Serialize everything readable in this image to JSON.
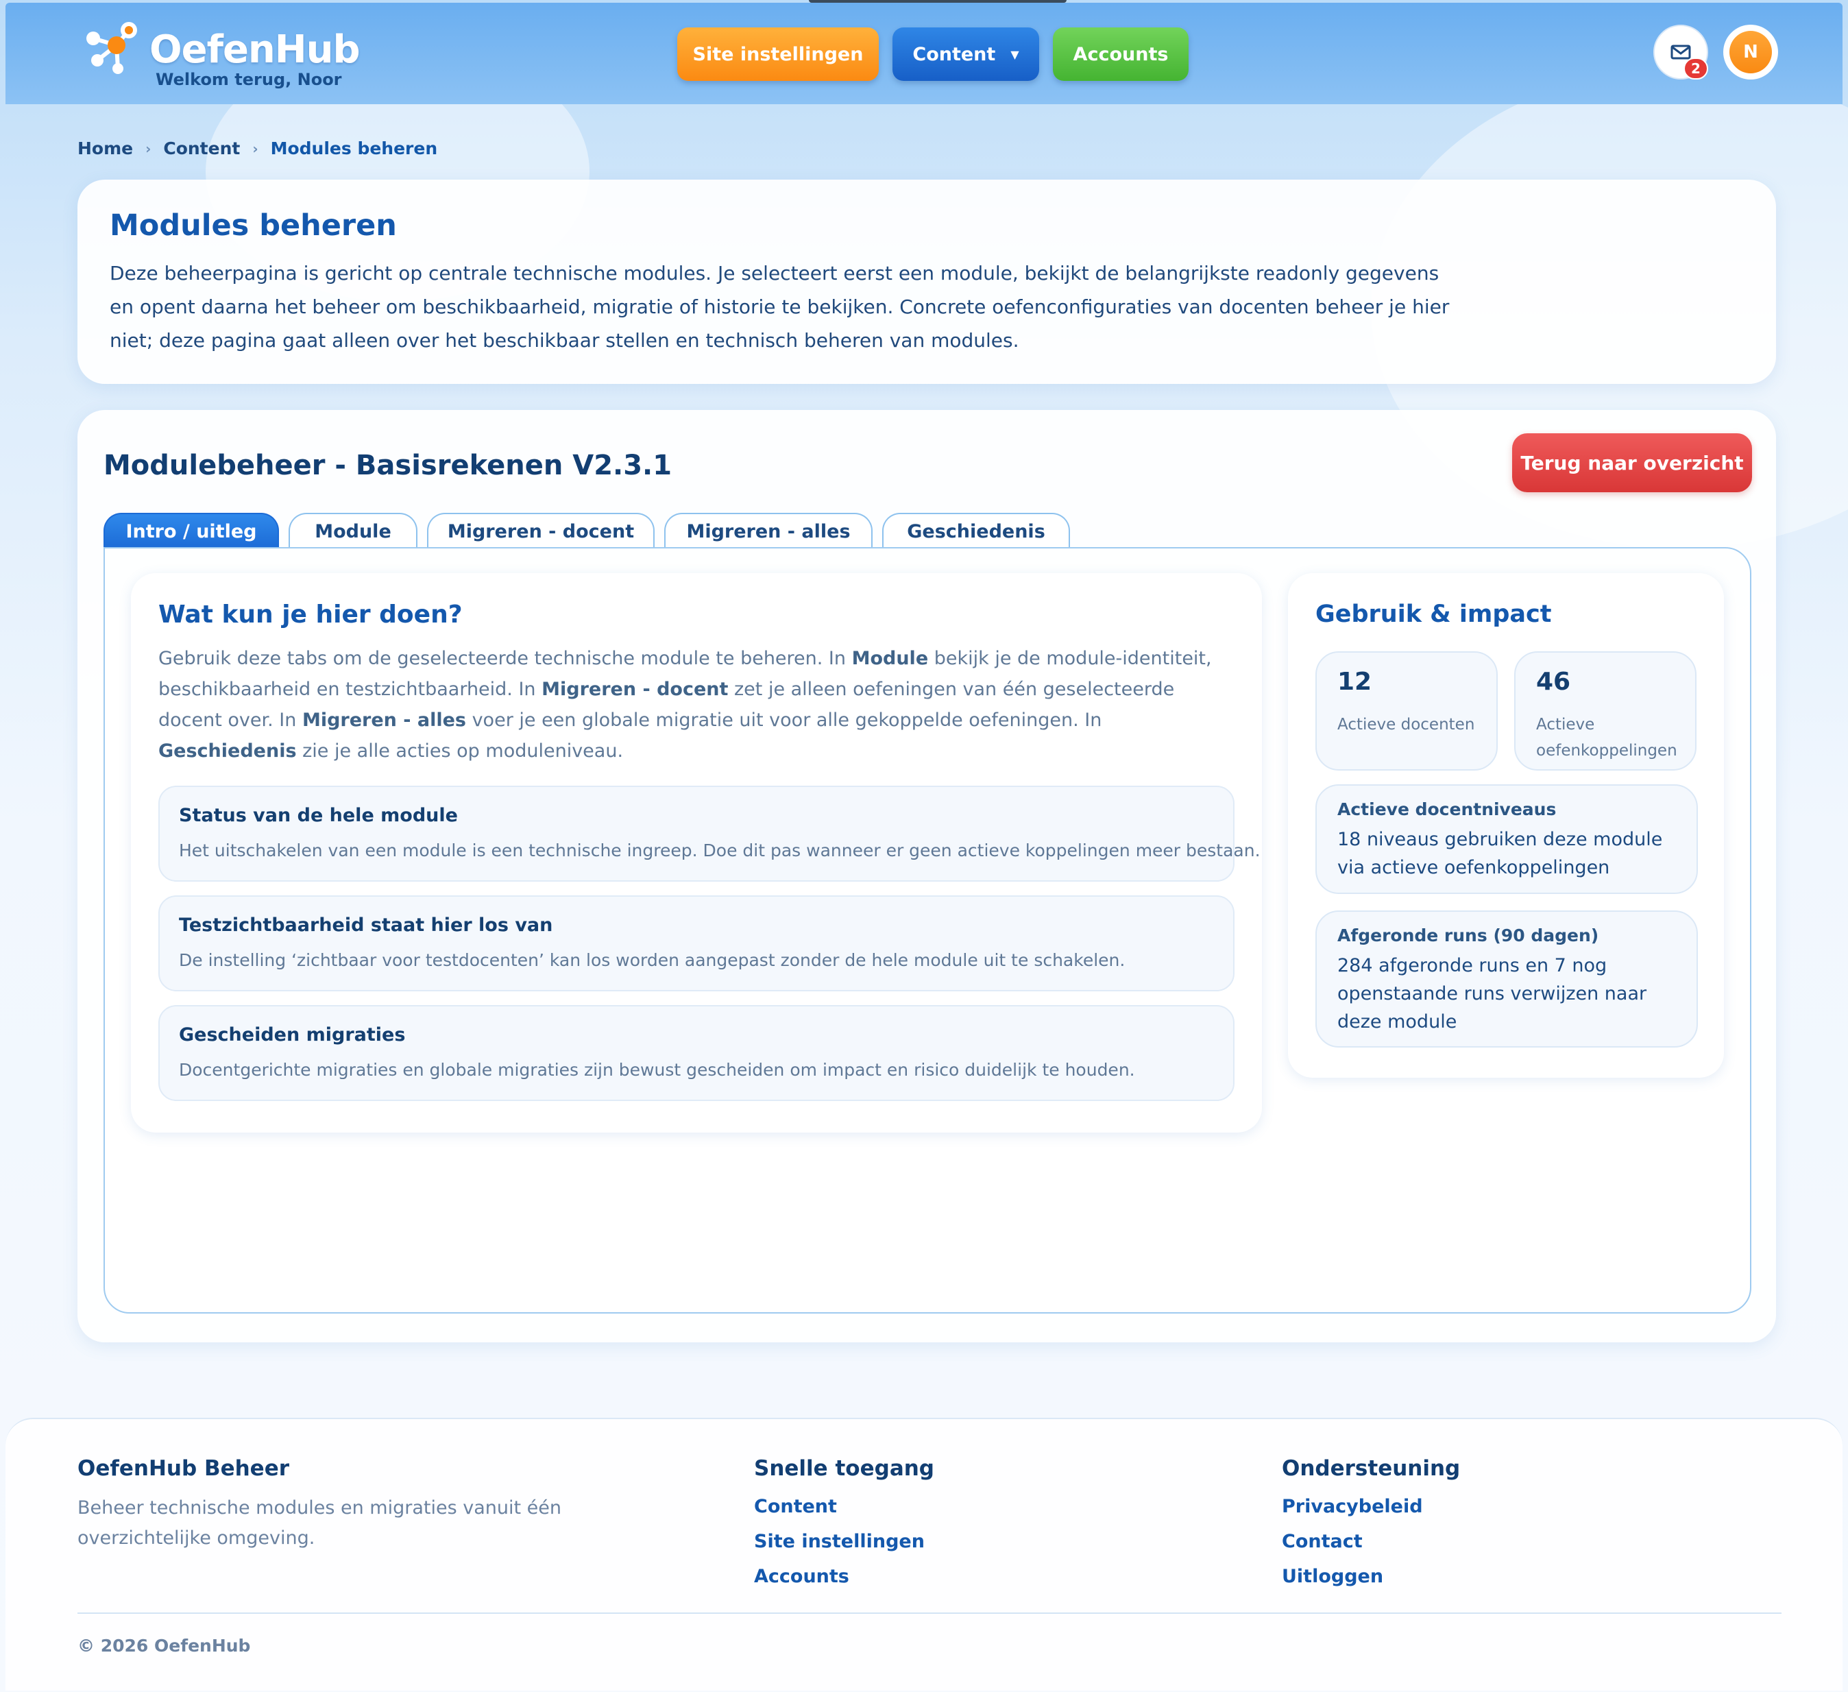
{
  "header": {
    "brand": "OefenHub",
    "welcome": "Welkom terug, Noor",
    "nav": {
      "site_settings": "Site instellingen",
      "content": "Content",
      "accounts": "Accounts"
    },
    "mail_badge": "2",
    "avatar_initial": "N"
  },
  "breadcrumb": {
    "items": [
      "Home",
      "Content",
      "Modules beheren"
    ]
  },
  "intro": {
    "title": "Modules beheren",
    "text": "Deze beheerpagina is gericht op centrale technische modules. Je selecteert eerst een module, bekijkt de belangrijkste readonly gegevens en opent daarna het beheer om beschikbaarheid, migratie of historie te bekijken. Concrete oefenconfiguraties van docenten beheer je hier niet; deze pagina gaat alleen over het beschikbaar stellen en technisch beheren van modules."
  },
  "main": {
    "title": "Modulebeheer - Basisrekenen V2.3.1",
    "back_button": "Terug naar overzicht",
    "tabs": [
      "Intro / uitleg",
      "Module",
      "Migreren - docent",
      "Migreren - alles",
      "Geschiedenis"
    ],
    "active_tab": "Intro / uitleg"
  },
  "explain": {
    "title": "Wat kun je hier doen?",
    "text_parts": [
      "Gebruik deze tabs om de geselecteerde technische module te beheren. In ",
      "Module",
      " bekijk je de module-identiteit, beschikbaarheid en testzichtbaarheid. In ",
      "Migreren - docent",
      " zet je alleen oefeningen van één geselecteerde docent over. In ",
      "Migreren - alles",
      " voer je een globale migratie uit voor alle gekoppelde oefeningen. In ",
      "Geschiedenis",
      " zie je alle acties op moduleniveau."
    ],
    "boxes": [
      {
        "title": "Status van de hele module",
        "text": "Het uitschakelen van een module is een technische ingreep. Doe dit pas wanneer er geen actieve koppelingen meer bestaan."
      },
      {
        "title": "Testzichtbaarheid staat hier los van",
        "text": "De instelling ‘zichtbaar voor testdocenten’ kan los worden aangepast zonder de hele module uit te schakelen."
      },
      {
        "title": "Gescheiden migraties",
        "text": "Docentgerichte migraties en globale migraties zijn bewust gescheiden om impact en risico duidelijk te houden."
      }
    ]
  },
  "impact": {
    "title": "Gebruik & impact",
    "stats": [
      {
        "value": "12",
        "label": "Actieve docenten"
      },
      {
        "value": "46",
        "label": "Actieve oefenkoppelingen"
      }
    ],
    "levels": {
      "title": "Actieve docentniveaus",
      "text": "18 niveaus gebruiken deze module via actieve oefenkoppelingen"
    },
    "runs": {
      "title": "Afgeronde runs (90 dagen)",
      "text": "284 afgeronde runs en 7 nog openstaande runs verwijzen naar deze module"
    }
  },
  "footer": {
    "about_title": "OefenHub Beheer",
    "about_text": "Beheer technische modules en migraties vanuit één overzichtelijke omgeving.",
    "quick_title": "Snelle toegang",
    "quick_links": [
      "Content",
      "Site instellingen",
      "Accounts"
    ],
    "support_title": "Ondersteuning",
    "support_links": [
      "Privacybeleid",
      "Contact",
      "Uitloggen"
    ],
    "copyright": "© 2026 OefenHub"
  },
  "colors": {
    "accent_blue": "#1458ad",
    "orange": "#fb8a12",
    "green": "#45b432",
    "red": "#d93737"
  }
}
